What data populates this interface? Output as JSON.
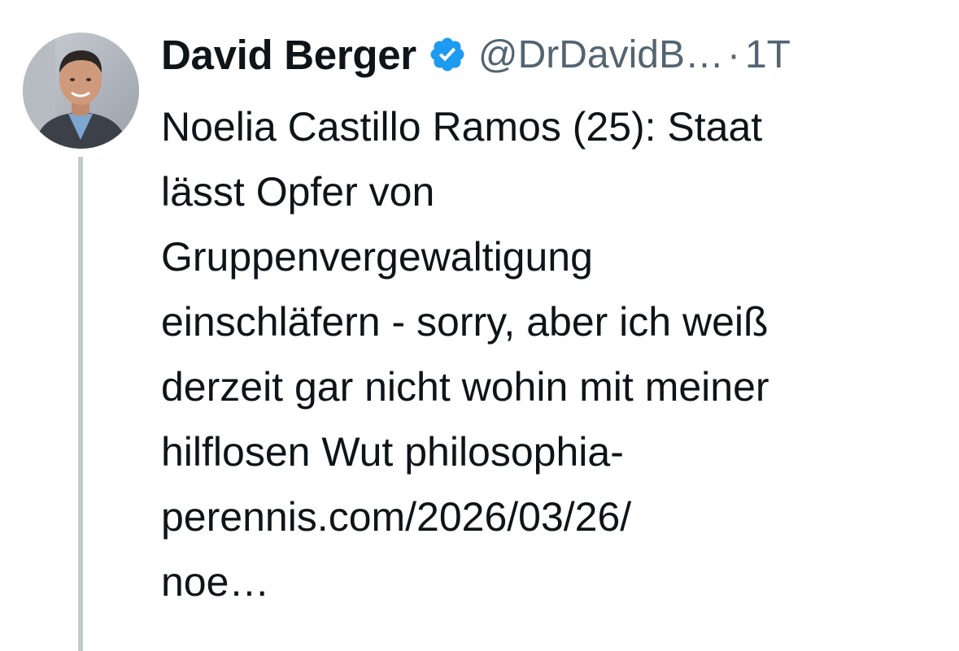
{
  "tweet": {
    "author_name": "David Berger",
    "handle": "@DrDavidB…",
    "separator": "·",
    "time": "1T",
    "verified": true,
    "avatar_icon": "profile-photo",
    "text_lines": [
      "Noelia Castillo Ramos (25): Staat",
      "lässt Opfer von",
      "Gruppenvergewaltigung",
      "einschläfern - sorry, aber ich weiß",
      "derzeit gar nicht wohin mit meiner",
      "hilflosen Wut philosophia-",
      "perennis.com/2026/03/26/",
      "noe…"
    ]
  },
  "colors": {
    "verified_badge": "#1d9bf0",
    "secondary_text": "#536471",
    "primary_text": "#0f1419",
    "thread_line": "#c4c9ce"
  }
}
